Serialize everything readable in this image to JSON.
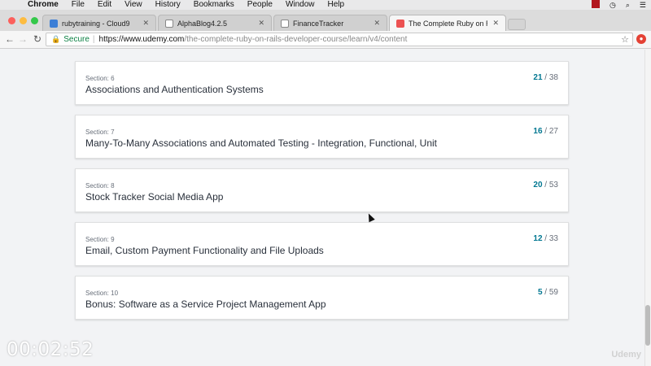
{
  "menubar": {
    "app": "Chrome",
    "items": [
      "File",
      "Edit",
      "View",
      "History",
      "Bookmarks",
      "People",
      "Window",
      "Help"
    ]
  },
  "tabs": [
    {
      "title": "rubytraining - Cloud9",
      "favicon_color": "#3d7fd6",
      "active": false
    },
    {
      "title": "AlphaBlog4.2.5",
      "favicon_color": "#888888",
      "active": false
    },
    {
      "title": "FinanceTracker",
      "favicon_color": "#888888",
      "active": false
    },
    {
      "title": "The Complete Ruby on Rails D",
      "favicon_color": "#ec5252",
      "active": true
    }
  ],
  "address": {
    "secure_label": "Secure",
    "domain": "https://www.udemy.com",
    "path": "/the-complete-ruby-on-rails-developer-course/learn/v4/content"
  },
  "sections": [
    {
      "section_label": "Section: 6",
      "title": "Associations and Authentication Systems",
      "completed": "21",
      "total": " / 38"
    },
    {
      "section_label": "Section: 7",
      "title": "Many-To-Many Associations and Automated Testing - Integration, Functional, Unit",
      "completed": "16",
      "total": " / 27"
    },
    {
      "section_label": "Section: 8",
      "title": "Stock Tracker Social Media App",
      "completed": "20",
      "total": " / 53"
    },
    {
      "section_label": "Section: 9",
      "title": "Email, Custom Payment Functionality and File Uploads",
      "completed": "12",
      "total": " / 33"
    },
    {
      "section_label": "Section: 10",
      "title": "Bonus: Software as a Service Project Management App",
      "completed": "5",
      "total": " / 59"
    }
  ],
  "overlay": {
    "timer": "00:02:52",
    "watermark": "Udemy"
  },
  "colors": {
    "accent": "#007791",
    "secure_green": "#0b8043",
    "udemy_red": "#ec5252"
  }
}
